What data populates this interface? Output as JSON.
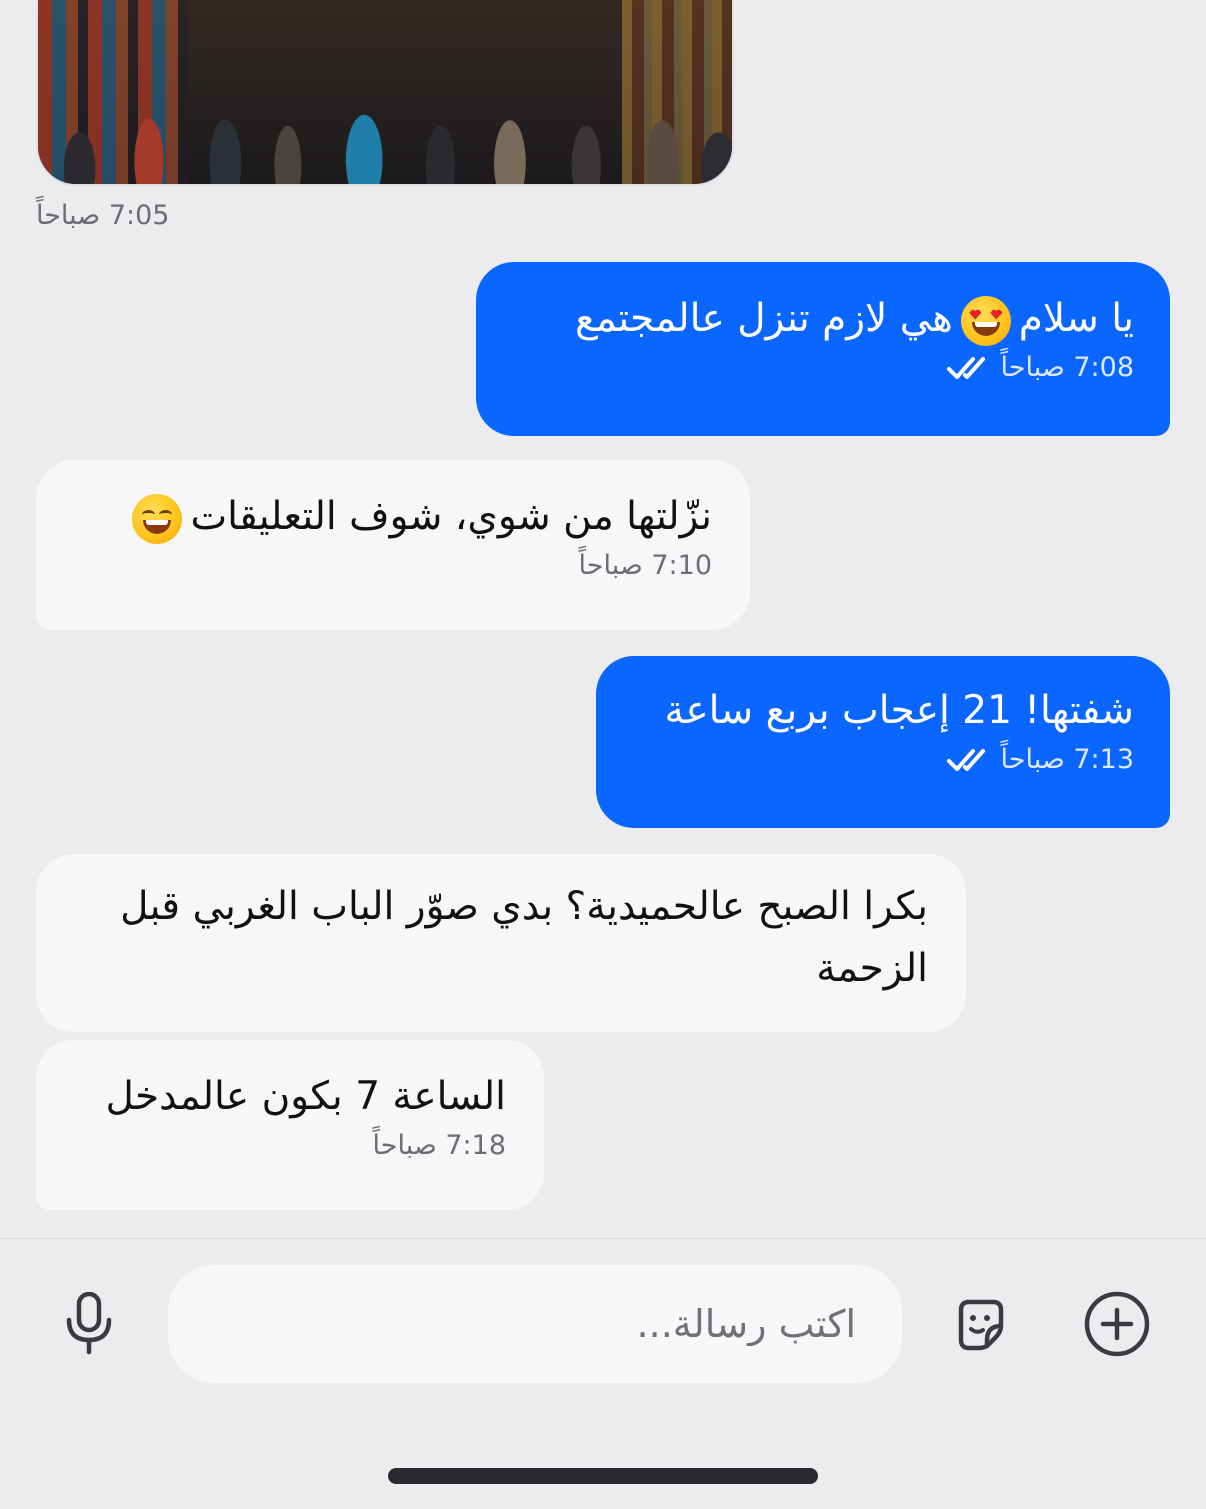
{
  "photo_message": {
    "time": "7:05 صباحاً"
  },
  "messages": [
    {
      "direction": "out",
      "text_before": "يا سلام",
      "emoji": "heart-eyes-emoji",
      "text_after": "هي لازم تنزل عالمجتمع",
      "time": "7:08 صباحاً",
      "status": "read"
    },
    {
      "direction": "in",
      "text_before": "نزّلتها من شوي، شوف التعليقات",
      "emoji": "grinning-emoji",
      "time": "7:10 صباحاً"
    },
    {
      "direction": "out",
      "text": "شفتها! 21 إعجاب بربع ساعة",
      "time": "7:13 صباحاً",
      "status": "read"
    },
    {
      "direction": "in",
      "text": "بكرا الصبح عالحميدية؟ بدي صوّر الباب الغربي قبل الزحمة"
    },
    {
      "direction": "in",
      "text": "الساعة 7 بكون عالمدخل",
      "time": "7:18 صباحاً"
    }
  ],
  "composer": {
    "placeholder": "اكتب رسالة...",
    "icons": [
      "add-icon",
      "sticker-icon",
      "microphone-icon"
    ]
  },
  "colors": {
    "outgoing_bubble": "#0a66ff",
    "incoming_bubble": "#f7f7f9",
    "background": "#ececef"
  }
}
